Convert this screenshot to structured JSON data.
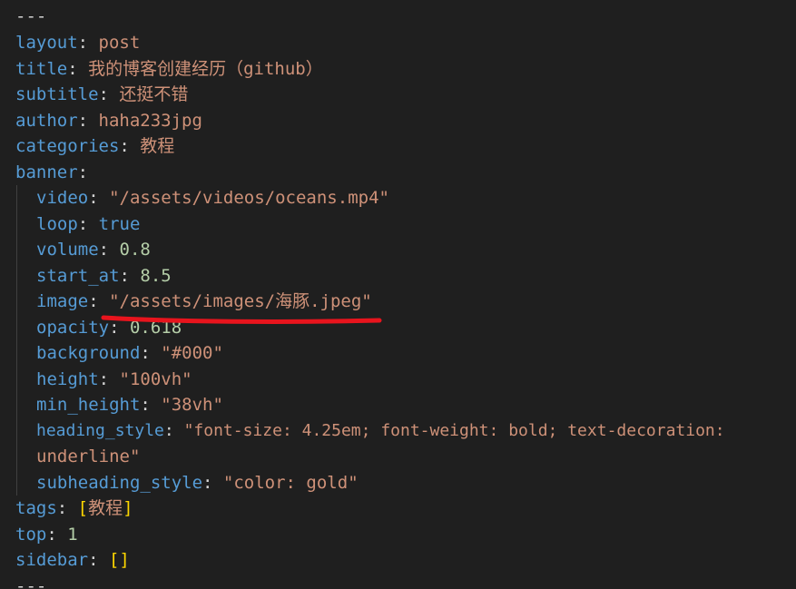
{
  "lines": {
    "l0": "---",
    "l1k": "layout",
    "l1v": "post",
    "l2k": "title",
    "l2v": "我的博客创建经历（github）",
    "l3k": "subtitle",
    "l3v": "还挺不错",
    "l4k": "author",
    "l4v": "haha233jpg",
    "l5k": "categories",
    "l5v": "教程",
    "l6k": "banner",
    "l7k": "video",
    "l7v": "\"/assets/videos/oceans.mp4\"",
    "l8k": "loop",
    "l8v": "true",
    "l9k": "volume",
    "l9v": "0.8",
    "l10k": "start_at",
    "l10v": "8.5",
    "l11k": "image",
    "l11v": "\"/assets/images/海豚.jpeg\"",
    "l12k": "opacity",
    "l12v": "0.618",
    "l13k": "background",
    "l13v": "\"#000\"",
    "l14k": "height",
    "l14v": "\"100vh\"",
    "l15k": "min_height",
    "l15v": "\"38vh\"",
    "l16k": "heading_style",
    "l16v": "\"font-size: 4.25em; font-weight: bold; text-decoration:",
    "l17v": "underline\"",
    "l18k": "subheading_style",
    "l18v": "\"color: gold\"",
    "l19k": "tags",
    "l19o": "[",
    "l19v": "教程",
    "l19c": "]",
    "l20k": "top",
    "l20v": "1",
    "l21k": "sidebar",
    "l21v": "[]",
    "l22": "---"
  },
  "colors": {
    "background": "#1f1f1f",
    "key": "#569cd6",
    "string": "#ce9178",
    "number": "#b5cea8",
    "bracket": "#ffd700",
    "annotation": "#e8141d"
  }
}
